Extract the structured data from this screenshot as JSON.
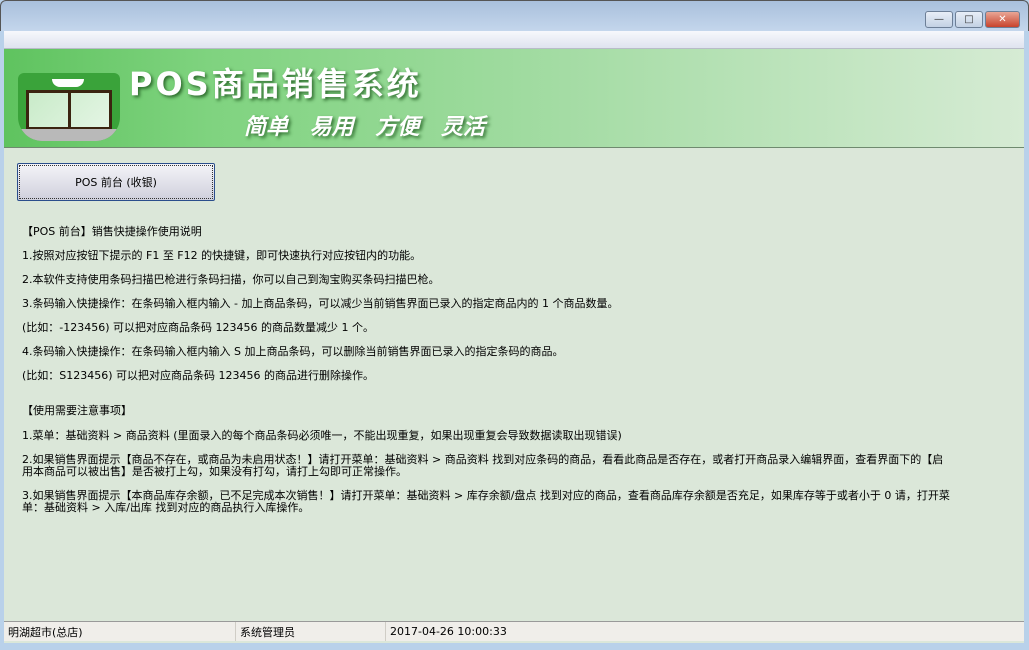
{
  "window": {
    "minimize": "—",
    "maximize": "□",
    "close": "✕"
  },
  "banner": {
    "title": "POS商品销售系统",
    "slogan": "简单 易用 方便 灵活"
  },
  "pos_button": "POS 前台 (收银)",
  "instructions": {
    "heading": "【POS 前台】销售快捷操作使用说明",
    "lines": [
      "1.按照对应按钮下提示的 F1 至 F12 的快捷键，即可快速执行对应按钮内的功能。",
      "2.本软件支持使用条码扫描巴枪进行条码扫描，你可以自己到淘宝购买条码扫描巴枪。",
      "3.条码输入快捷操作：在条码输入框内输入 - 加上商品条码，可以减少当前销售界面已录入的指定商品内的 1 个商品数量。",
      "(比如：-123456) 可以把对应商品条码 123456 的商品数量减少 1 个。",
      "4.条码输入快捷操作：在条码输入框内输入 S 加上商品条码，可以删除当前销售界面已录入的指定条码的商品。",
      "(比如：S123456) 可以把对应商品条码 123456 的商品进行删除操作。"
    ]
  },
  "notes": {
    "heading": "【使用需要注意事项】",
    "lines": [
      "1.菜单：基础资料 > 商品资料 (里面录入的每个商品条码必须唯一，不能出现重复，如果出现重复会导致数据读取出现错误)",
      "2.如果销售界面提示【商品不存在，或商品为未启用状态！】请打开菜单：基础资料 > 商品资料 找到对应条码的商品，看看此商品是否存在，或者打开商品录入编辑界面，查看界面下的【启用本商品可以被出售】是否被打上勾，如果没有打勾，请打上勾即可正常操作。",
      "3.如果销售界面提示【本商品库存余额，已不足完成本次销售！】请打开菜单：基础资料 > 库存余额/盘点 找到对应的商品，查看商品库存余额是否充足，如果库存等于或者小于 0 请，打开菜单：基础资料 > 入库/出库 找到对应的商品执行入库操作。"
    ]
  },
  "statusbar": {
    "store": "明湖超市(总店)",
    "user": "系统管理员",
    "datetime": "2017-04-26 10:00:33"
  }
}
